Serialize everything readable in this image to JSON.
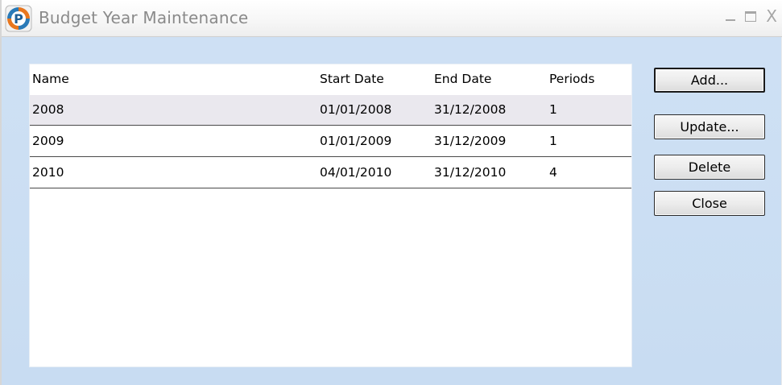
{
  "window": {
    "title": "Budget Year Maintenance"
  },
  "icons": {
    "app": "app-logo-icon",
    "minimize": "minimize-icon",
    "maximize": "maximize-icon",
    "close": "close-icon"
  },
  "controls": {
    "minimize_glyph": "_",
    "close_glyph": "X"
  },
  "grid": {
    "columns": [
      "Name",
      "Start Date",
      "End Date",
      "Periods"
    ],
    "rows": [
      {
        "name": "2008",
        "start": "01/01/2008",
        "end": "31/12/2008",
        "periods": "1"
      },
      {
        "name": "2009",
        "start": "01/01/2009",
        "end": "31/12/2009",
        "periods": "1"
      },
      {
        "name": "2010",
        "start": "04/01/2010",
        "end": "31/12/2010",
        "periods": "4"
      }
    ],
    "selected_row": 0
  },
  "buttons": {
    "add": "Add...",
    "update": "Update...",
    "delete": "Delete",
    "close": "Close"
  },
  "colors": {
    "window_bg": "#cfe1f4",
    "selected_row": "#eae8ee",
    "title_text": "#8a8a8a"
  }
}
